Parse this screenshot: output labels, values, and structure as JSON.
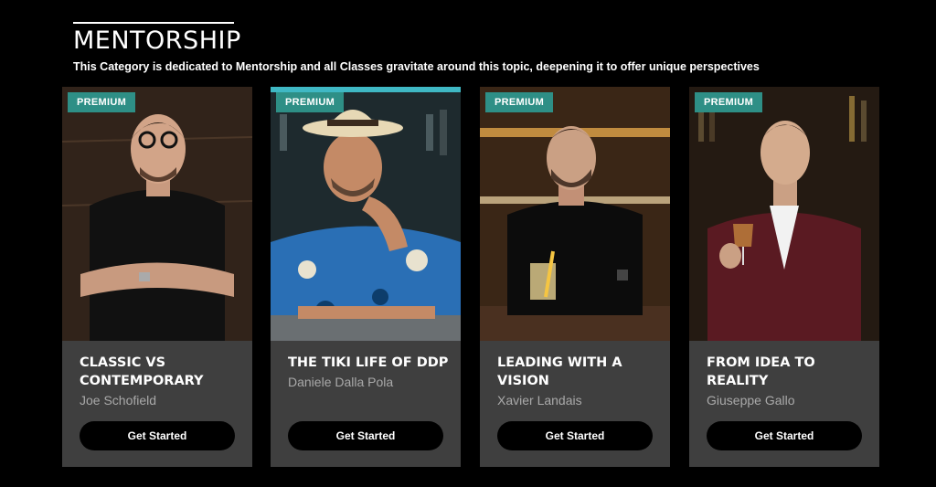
{
  "header": {
    "title": "MENTORSHIP",
    "subtitle": "This Category is dedicated to Mentorship and all Classes gravitate around this topic, deepening it to offer unique perspectives"
  },
  "cards": [
    {
      "badge": "PREMIUM",
      "title": "CLASSIC VS CONTEMPORARY",
      "mentor": "Joe Schofield",
      "cta": "Get Started"
    },
    {
      "badge": "PREMIUM",
      "title": "THE TIKI LIFE OF DDP",
      "mentor": "Daniele Dalla Pola",
      "cta": "Get Started"
    },
    {
      "badge": "PREMIUM",
      "title": "LEADING WITH A VISION",
      "mentor": "Xavier Landais",
      "cta": "Get Started"
    },
    {
      "badge": "PREMIUM",
      "title": "FROM IDEA TO REALITY",
      "mentor": "Giuseppe Gallo",
      "cta": "Get Started"
    }
  ],
  "colors": {
    "badge": "#2e8f86",
    "card": "#3f3f3f",
    "button": "#000000",
    "mentor_text": "#a9a9a9"
  }
}
